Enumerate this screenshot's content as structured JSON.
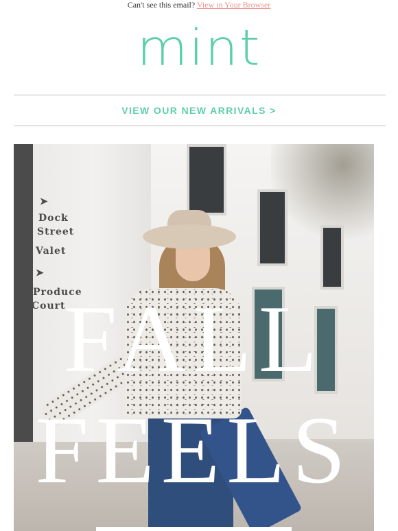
{
  "preheader": {
    "text": "Can't see this email?",
    "link_label": "View in Your Browser"
  },
  "brand": {
    "logo_text": "mint",
    "accent_color": "#5ccfa9",
    "link_color": "#e8928c"
  },
  "nav": {
    "new_arrivals_label": "VIEW OUR NEW ARRIVALS >"
  },
  "hero": {
    "headline_line1": "FALL",
    "headline_line2": "FEELS",
    "signs": [
      "Dock",
      "Street",
      "Valet",
      "Produce",
      "Court"
    ]
  }
}
